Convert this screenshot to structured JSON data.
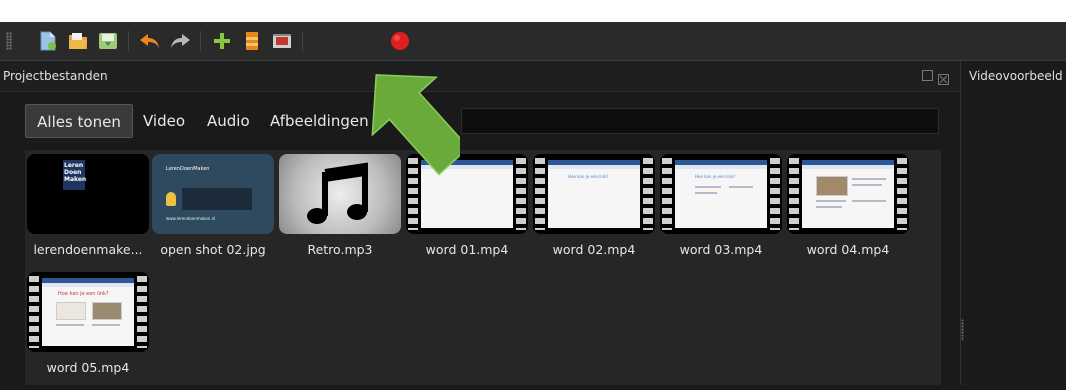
{
  "toolbar": {
    "buttons": [
      {
        "name": "new-project-icon",
        "color": "#9bc3e6"
      },
      {
        "name": "open-project-icon",
        "color": "#e8a63a"
      },
      {
        "name": "save-project-icon",
        "color": "#7fbf4d"
      },
      {
        "name": "undo-icon",
        "color": "#e8861c"
      },
      {
        "name": "redo-icon",
        "color": "#b8b8b8"
      },
      {
        "name": "add-track-icon",
        "color": "#8cc63f"
      },
      {
        "name": "import-files-icon",
        "color": "#e8861c"
      },
      {
        "name": "export-video-icon",
        "color": "#d0d0d0"
      },
      {
        "name": "record-icon",
        "color": "#e02020"
      }
    ]
  },
  "project_files": {
    "title": "Projectbestanden",
    "filters": [
      "Alles tonen",
      "Video",
      "Audio",
      "Afbeeldingen"
    ],
    "search_value": "",
    "files": [
      {
        "label": "lerendoenmake...",
        "thumb_text": [
          "Leren",
          "Doen",
          "Maken"
        ]
      },
      {
        "label": "open shot 02.jpg",
        "thumb_text": [
          "LerenDoenMaken",
          "www.lerendoenmaken.nl"
        ]
      },
      {
        "label": "Retro.mp3"
      },
      {
        "label": "word 01.mp4"
      },
      {
        "label": "word 02.mp4",
        "thumb_text": [
          "Hoe kan je een link?"
        ]
      },
      {
        "label": "word 03.mp4",
        "thumb_text": [
          "Hoe kan je een link?"
        ]
      },
      {
        "label": "word 04.mp4"
      },
      {
        "label": "word 05.mp4",
        "thumb_text": [
          "Hoe kan je een link?"
        ]
      }
    ]
  },
  "video_preview": {
    "title": "Videovoorbeeld"
  },
  "colors": {
    "accent_arrow": "#6aaa3a",
    "panel_bg": "#262626",
    "selected_tab_bg": "#3a3a3a"
  }
}
